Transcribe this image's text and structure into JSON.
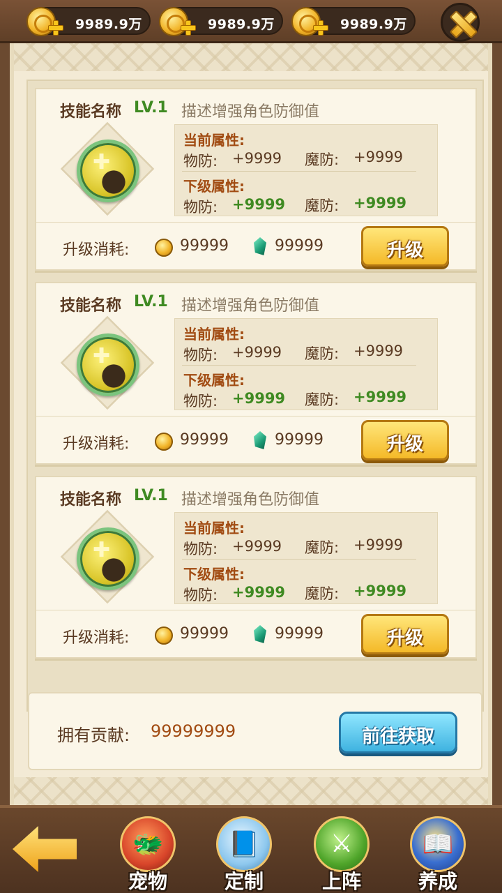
{
  "topbar": {
    "currencies": [
      {
        "amount": "9989.9万",
        "icon": "gold-coin-plus-icon"
      },
      {
        "amount": "9989.9万",
        "icon": "gold-coin-plus-icon"
      },
      {
        "amount": "9989.9万",
        "icon": "gold-coin-plus-icon"
      }
    ],
    "close_icon": "close-x-icon"
  },
  "skills": [
    {
      "name": "技能名称",
      "level": "LV.1",
      "description": "描述增强角色防御值",
      "current_header": "当前属性:",
      "current_phys_label": "物防:",
      "current_phys_value": "+9999",
      "current_magic_label": "魔防:",
      "current_magic_value": "+9999",
      "next_header": "下级属性:",
      "next_phys_label": "物防:",
      "next_phys_value": "+9999",
      "next_magic_label": "魔防:",
      "next_magic_value": "+9999",
      "cost_label": "升级消耗:",
      "cost_coin": "99999",
      "cost_gem": "99999",
      "upgrade_label": "升级"
    },
    {
      "name": "技能名称",
      "level": "LV.1",
      "description": "描述增强角色防御值",
      "current_header": "当前属性:",
      "current_phys_label": "物防:",
      "current_phys_value": "+9999",
      "current_magic_label": "魔防:",
      "current_magic_value": "+9999",
      "next_header": "下级属性:",
      "next_phys_label": "物防:",
      "next_phys_value": "+9999",
      "next_magic_label": "魔防:",
      "next_magic_value": "+9999",
      "cost_label": "升级消耗:",
      "cost_coin": "99999",
      "cost_gem": "99999",
      "upgrade_label": "升级"
    },
    {
      "name": "技能名称",
      "level": "LV.1",
      "description": "描述增强角色防御值",
      "current_header": "当前属性:",
      "current_phys_label": "物防:",
      "current_phys_value": "+9999",
      "current_magic_label": "魔防:",
      "current_magic_value": "+9999",
      "next_header": "下级属性:",
      "next_phys_label": "物防:",
      "next_phys_value": "+9999",
      "next_magic_label": "魔防:",
      "next_magic_value": "+9999",
      "cost_label": "升级消耗:",
      "cost_coin": "99999",
      "cost_gem": "99999",
      "upgrade_label": "升级"
    }
  ],
  "contribution": {
    "label": "拥有贡献:",
    "value": "99999999",
    "button_label": "前往获取"
  },
  "bottom_nav": {
    "back_icon": "back-arrow-icon",
    "items": [
      {
        "label": "宠物",
        "icon": "pet-dragon-icon"
      },
      {
        "label": "定制",
        "icon": "book-custom-icon"
      },
      {
        "label": "上阵",
        "icon": "sword-laurel-icon"
      },
      {
        "label": "养成",
        "icon": "training-book-icon"
      }
    ]
  },
  "colors": {
    "level_green": "#3f8a22",
    "attr_header": "#a14b12",
    "upgrade_button": "#f4b928",
    "go_button": "#3fb3e0"
  }
}
